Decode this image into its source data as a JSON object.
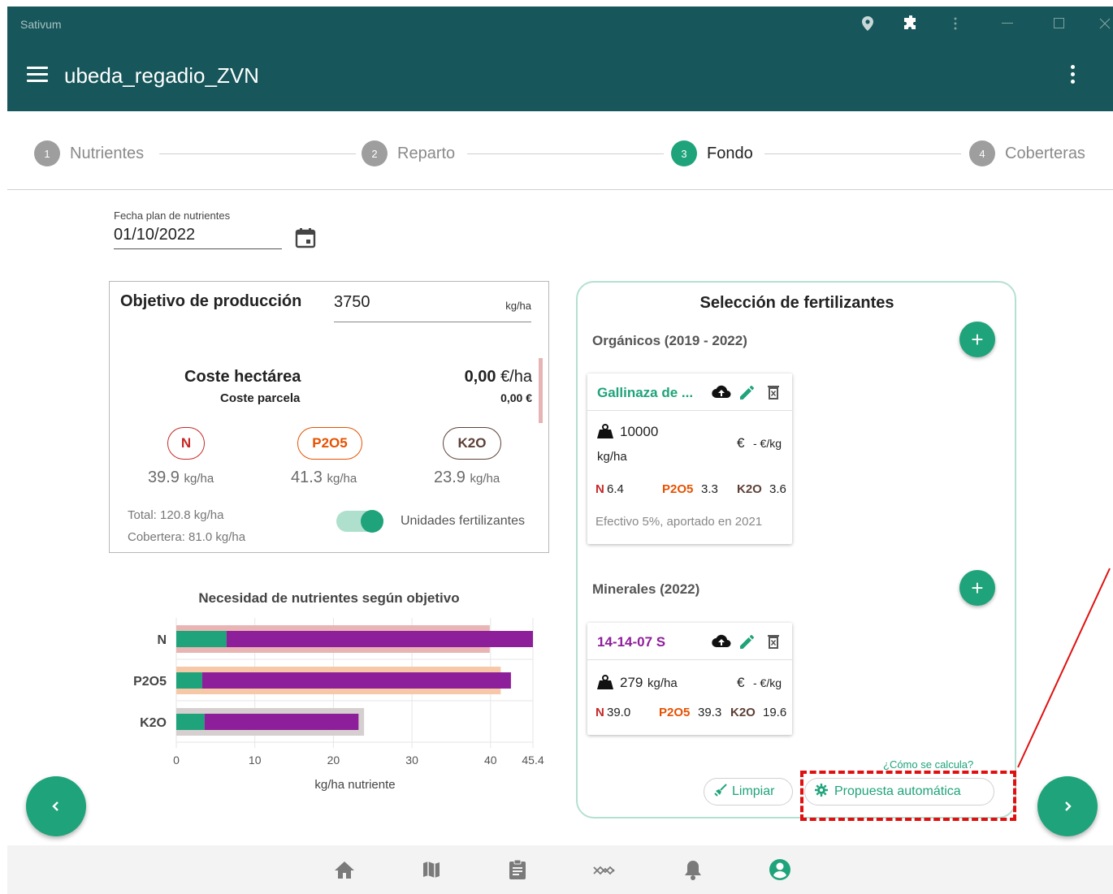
{
  "window": {
    "app_name": "Sativum"
  },
  "appbar": {
    "title": "ubeda_regadio_ZVN"
  },
  "stepper": [
    {
      "num": "1",
      "label": "Nutrientes"
    },
    {
      "num": "2",
      "label": "Reparto"
    },
    {
      "num": "3",
      "label": "Fondo"
    },
    {
      "num": "4",
      "label": "Coberteras"
    }
  ],
  "active_step": 3,
  "date": {
    "label": "Fecha plan de nutrientes",
    "value": "01/10/2022"
  },
  "objective": {
    "title": "Objetivo de producción",
    "value": "3750",
    "unit": "kg/ha",
    "cost_title": "Coste hectárea",
    "cost_sub": "Coste parcela",
    "cost_ha_value": "0,00",
    "cost_ha_unit": "€/ha",
    "cost_parcel_value": "0,00 €",
    "nutrients": [
      {
        "label": "N",
        "value": "39.9",
        "unit": "kg/ha",
        "color": "#c62828"
      },
      {
        "label": "P2O5",
        "value": "41.3",
        "unit": "kg/ha",
        "color": "#e65100"
      },
      {
        "label": "K2O",
        "value": "23.9",
        "unit": "kg/ha",
        "color": "#5d4037"
      }
    ],
    "total": "Total: 120.8 kg/ha",
    "cobertera": "Cobertera: 81.0 kg/ha",
    "toggle_label": "Unidades fertilizantes",
    "toggle_on": true
  },
  "chart_data": {
    "type": "bar",
    "title": "Necesidad de nutrientes según objetivo",
    "xlabel": "kg/ha nutriente",
    "categories": [
      "N",
      "P2O5",
      "K2O"
    ],
    "x_ticks": [
      "0",
      "10",
      "20",
      "30",
      "40",
      "45.4"
    ],
    "xlim": [
      0,
      45.4
    ],
    "series": [
      {
        "values": [
          39.9,
          41.3,
          23.9
        ],
        "colors": [
          "#e8b4b4",
          "#f7c8a8",
          "#d6cfcf"
        ]
      },
      {
        "values": [
          6.4,
          3.3,
          3.6
        ],
        "color": "#1fa37a"
      },
      {
        "values": [
          39.0,
          39.3,
          19.6
        ],
        "color": "#8e1f9a"
      }
    ]
  },
  "fertilizers": {
    "title": "Selección de fertilizantes",
    "organic_title": "Orgánicos (2019 - 2022)",
    "mineral_title": "Minerales (2022)",
    "organic": {
      "name": "Gallinaza de ...",
      "amount": "10000",
      "amount_unit": "kg/ha",
      "price": "€",
      "price_unit": "- €/kg",
      "n_label": "N",
      "n": "6.4",
      "p_label": "P2O5",
      "p": "3.3",
      "k_label": "K2O",
      "k": "3.6",
      "note": "Efectivo 5%, aportado en 2021"
    },
    "mineral": {
      "name": "14-14-07 S",
      "amount": "279",
      "amount_unit": "kg/ha",
      "price": "€",
      "price_unit": "- €/kg",
      "n_label": "N",
      "n": "39.0",
      "p_label": "P2O5",
      "p": "39.3",
      "k_label": "K2O",
      "k": "19.6"
    },
    "how_link": "¿Cómo se calcula?",
    "clear_label": "Limpiar",
    "auto_label": "Propuesta automática"
  },
  "colors": {
    "primary": "#17565a",
    "accent": "#1fa37a",
    "mineral": "#8e1f9a",
    "highlight": "#e01010"
  }
}
